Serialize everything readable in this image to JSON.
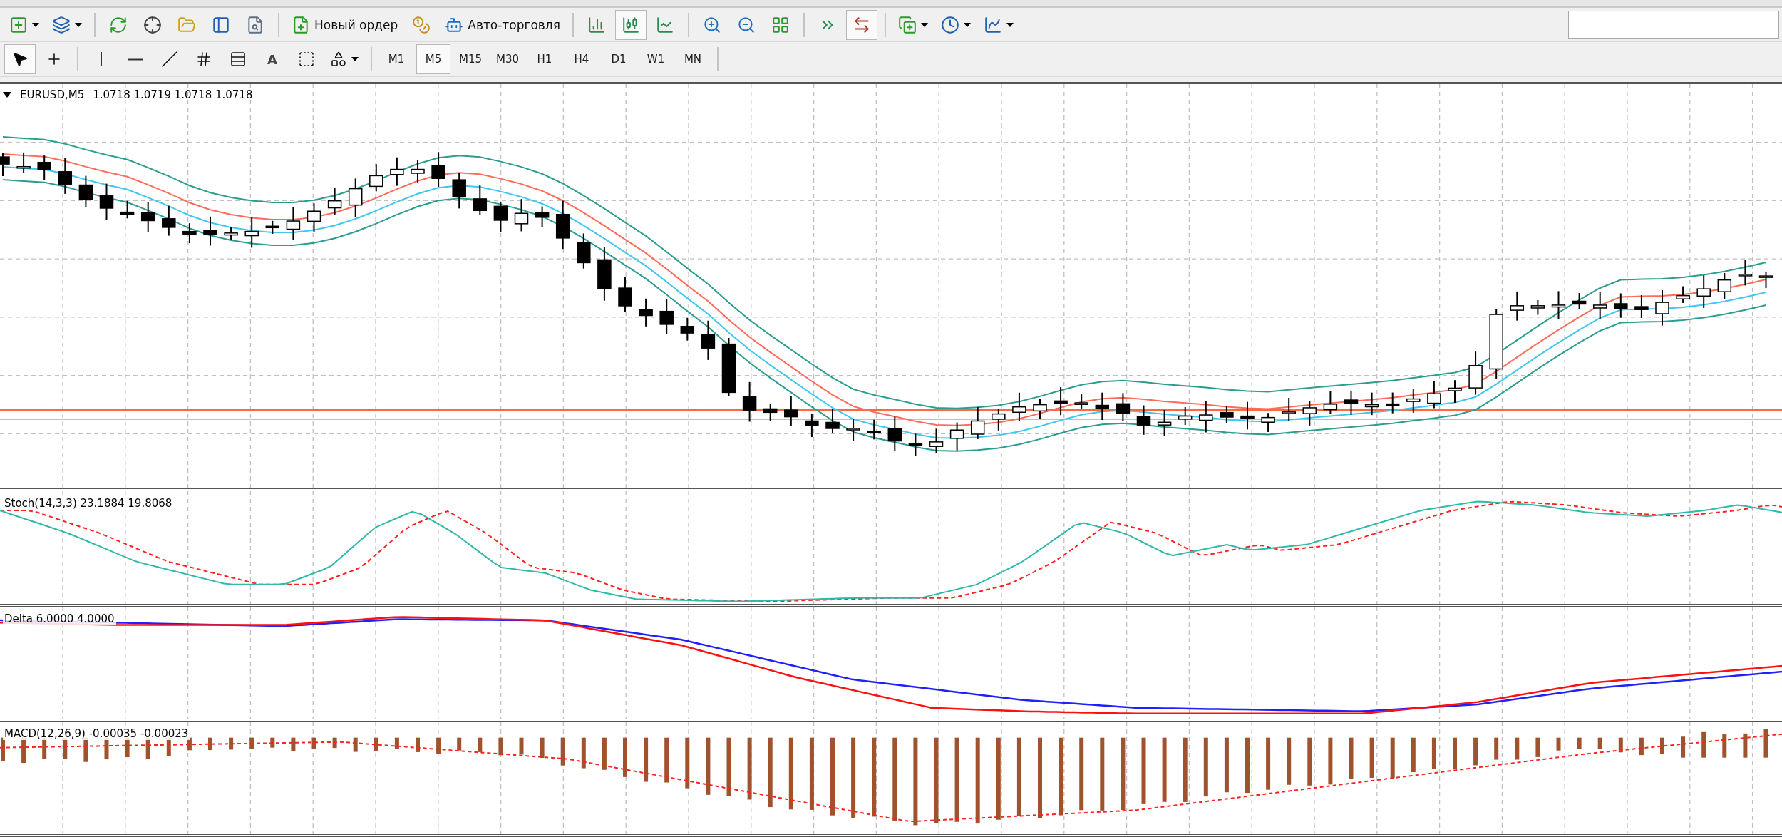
{
  "toolbar": {
    "new_order_button": "Новый ордер",
    "autotrading_button": "Авто-торговля",
    "chart_type_buttons": [
      {
        "selected": false
      },
      {
        "selected": true
      },
      {
        "selected": false
      }
    ],
    "chart_shift_buttons": [
      {
        "selected": false
      },
      {
        "selected": true
      }
    ]
  },
  "drawing_toolbar": {
    "tools": [
      {
        "kind": "cursor",
        "selected": true
      },
      {
        "kind": "crosshair",
        "selected": false
      },
      {
        "kind": "vline",
        "selected": false
      },
      {
        "kind": "hline",
        "selected": false
      },
      {
        "kind": "trendline",
        "selected": false
      },
      {
        "kind": "channel",
        "selected": false
      },
      {
        "kind": "fibo",
        "selected": false
      },
      {
        "kind": "text",
        "label": "A",
        "selected": false
      },
      {
        "kind": "textlabel",
        "selected": false
      },
      {
        "kind": "shapes",
        "selected": false
      }
    ]
  },
  "timeframes": [
    {
      "label": "M1",
      "selected": false
    },
    {
      "label": "M5",
      "selected": true
    },
    {
      "label": "M15",
      "selected": false
    },
    {
      "label": "M30",
      "selected": false
    },
    {
      "label": "H1",
      "selected": false
    },
    {
      "label": "H4",
      "selected": false
    },
    {
      "label": "D1",
      "selected": false
    },
    {
      "label": "W1",
      "selected": false
    },
    {
      "label": "MN",
      "selected": false
    }
  ],
  "chart": {
    "title": "EURUSD,M5",
    "quote": "1.0718 1.0719 1.0718 1.0718"
  },
  "indicators": [
    {
      "kind": "stochastic",
      "label": "Stoch(14,3,3) 23.1884 19.8068"
    },
    {
      "kind": "delta",
      "label": "Delta 6.0000 4.0000"
    },
    {
      "kind": "macd",
      "label": "MACD(12,26,9) -0.00035 -0.00023"
    }
  ]
}
